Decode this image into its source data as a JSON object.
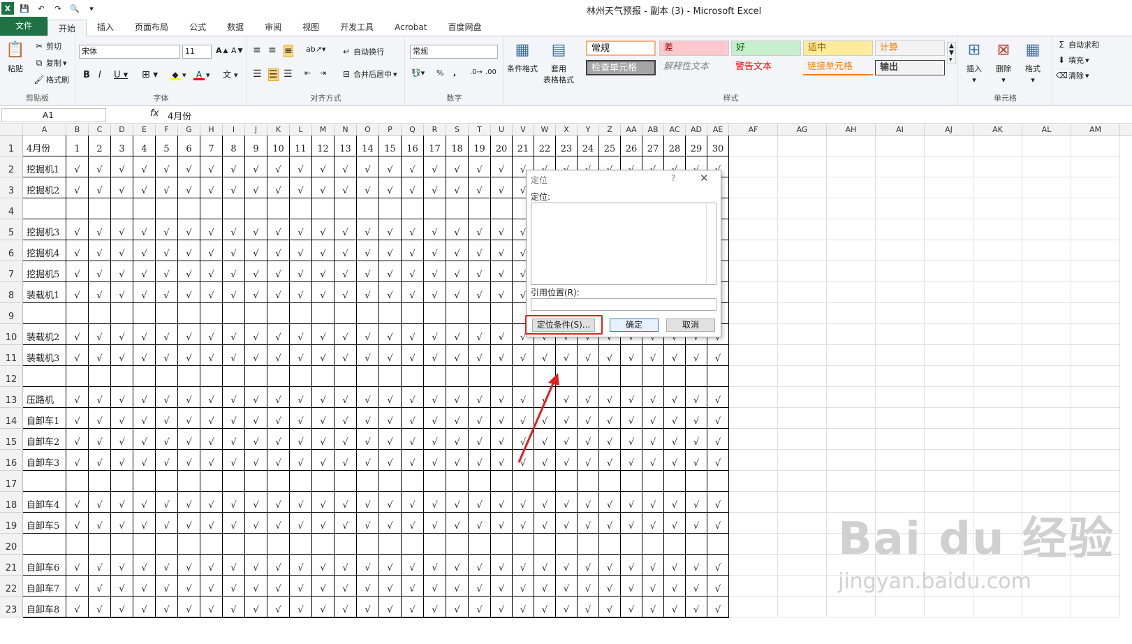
{
  "app": {
    "title": "林州天气预报 - 副本 (3) - Microsoft Excel"
  },
  "tabs": [
    "文件",
    "开始",
    "插入",
    "页面布局",
    "公式",
    "数据",
    "审阅",
    "视图",
    "开发工具",
    "Acrobat",
    "百度网盘"
  ],
  "ribbon": {
    "clipboard": {
      "paste": "粘贴",
      "cut": "剪切",
      "copy": "复制",
      "format_painter": "格式刷",
      "label": "剪贴板"
    },
    "font": {
      "name": "宋体",
      "size": "11",
      "label": "字体"
    },
    "alignment": {
      "wrap": "自动换行",
      "merge": "合并后居中",
      "label": "对齐方式"
    },
    "number": {
      "format": "常规",
      "label": "数字"
    },
    "styles": {
      "cond_format": "条件格式",
      "table_format": "套用\n表格格式",
      "label": "样式",
      "items": [
        {
          "text": "常规",
          "bg": "#ffffff",
          "color": "#000000"
        },
        {
          "text": "差",
          "bg": "#ffc7ce",
          "color": "#9c0006"
        },
        {
          "text": "好",
          "bg": "#c6efce",
          "color": "#006100"
        },
        {
          "text": "适中",
          "bg": "#ffeb9c",
          "color": "#9c6500"
        },
        {
          "text": "计算",
          "bg": "#f2f2f2",
          "color": "#fa7d00"
        },
        {
          "text": "检查单元格",
          "bg": "#a5a5a5",
          "color": "#ffffff"
        },
        {
          "text": "解释性文本",
          "bg": "#f3f5f8",
          "color": "#7f7f7f"
        },
        {
          "text": "警告文本",
          "bg": "#f3f5f8",
          "color": "#ff0000"
        },
        {
          "text": "链接单元格",
          "bg": "#f3f5f8",
          "color": "#fa7d00"
        },
        {
          "text": "输出",
          "bg": "#f2f2f2",
          "color": "#3f3f3f"
        }
      ]
    },
    "cells": {
      "insert": "插入",
      "delete": "删除",
      "format": "格式",
      "label": "单元格"
    },
    "editing": {
      "autosum": "自动求和",
      "fill": "填充",
      "clear": "清除"
    }
  },
  "formula_bar": {
    "name_box": "A1",
    "fx": "fx",
    "value": "4月份"
  },
  "columns": [
    "A",
    "B",
    "C",
    "D",
    "E",
    "F",
    "G",
    "H",
    "I",
    "J",
    "K",
    "L",
    "M",
    "N",
    "O",
    "P",
    "Q",
    "R",
    "S",
    "T",
    "U",
    "V",
    "W",
    "X",
    "Y",
    "Z",
    "AA",
    "AB",
    "AC",
    "AD",
    "AE",
    "AF",
    "AG",
    "AH",
    "AI",
    "AJ",
    "AK",
    "AL",
    "AM"
  ],
  "rows": [
    {
      "n": "1",
      "label": "4月份",
      "check": false
    },
    {
      "n": "2",
      "label": "挖掘机1",
      "check": true
    },
    {
      "n": "3",
      "label": "挖掘机2",
      "check": true
    },
    {
      "n": "4",
      "label": "",
      "check": false
    },
    {
      "n": "5",
      "label": "挖掘机3",
      "check": true
    },
    {
      "n": "6",
      "label": "挖掘机4",
      "check": true
    },
    {
      "n": "7",
      "label": "挖掘机5",
      "check": true
    },
    {
      "n": "8",
      "label": "装载机1",
      "check": true
    },
    {
      "n": "9",
      "label": "",
      "check": false
    },
    {
      "n": "10",
      "label": "装载机2",
      "check": true
    },
    {
      "n": "11",
      "label": "装载机3",
      "check": true
    },
    {
      "n": "12",
      "label": "",
      "check": false
    },
    {
      "n": "13",
      "label": "压路机",
      "check": true
    },
    {
      "n": "14",
      "label": "自卸车1",
      "check": true
    },
    {
      "n": "15",
      "label": "自卸车2",
      "check": true
    },
    {
      "n": "16",
      "label": "自卸车3",
      "check": true
    },
    {
      "n": "17",
      "label": "",
      "check": false
    },
    {
      "n": "18",
      "label": "自卸车4",
      "check": true
    },
    {
      "n": "19",
      "label": "自卸车5",
      "check": true
    },
    {
      "n": "20",
      "label": "",
      "check": false
    },
    {
      "n": "21",
      "label": "自卸车6",
      "check": true
    },
    {
      "n": "22",
      "label": "自卸车7",
      "check": true
    },
    {
      "n": "23",
      "label": "自卸车8",
      "check": true
    }
  ],
  "days": [
    "1",
    "2",
    "3",
    "4",
    "5",
    "6",
    "7",
    "8",
    "9",
    "10",
    "11",
    "12",
    "13",
    "14",
    "15",
    "16",
    "17",
    "18",
    "19",
    "20",
    "21",
    "22",
    "23",
    "24",
    "25",
    "26",
    "27",
    "28",
    "29",
    "30"
  ],
  "check_mark": "√",
  "dialog": {
    "title": "定位",
    "help": "?",
    "close": "✕",
    "list_label": "定位:",
    "ref_label": "引用位置(R):",
    "special_btn": "定位条件(S)...",
    "ok_btn": "确定",
    "cancel_btn": "取消"
  },
  "watermark": {
    "line1": "Bai du 经验",
    "line2": "jingyan.baidu.com"
  }
}
